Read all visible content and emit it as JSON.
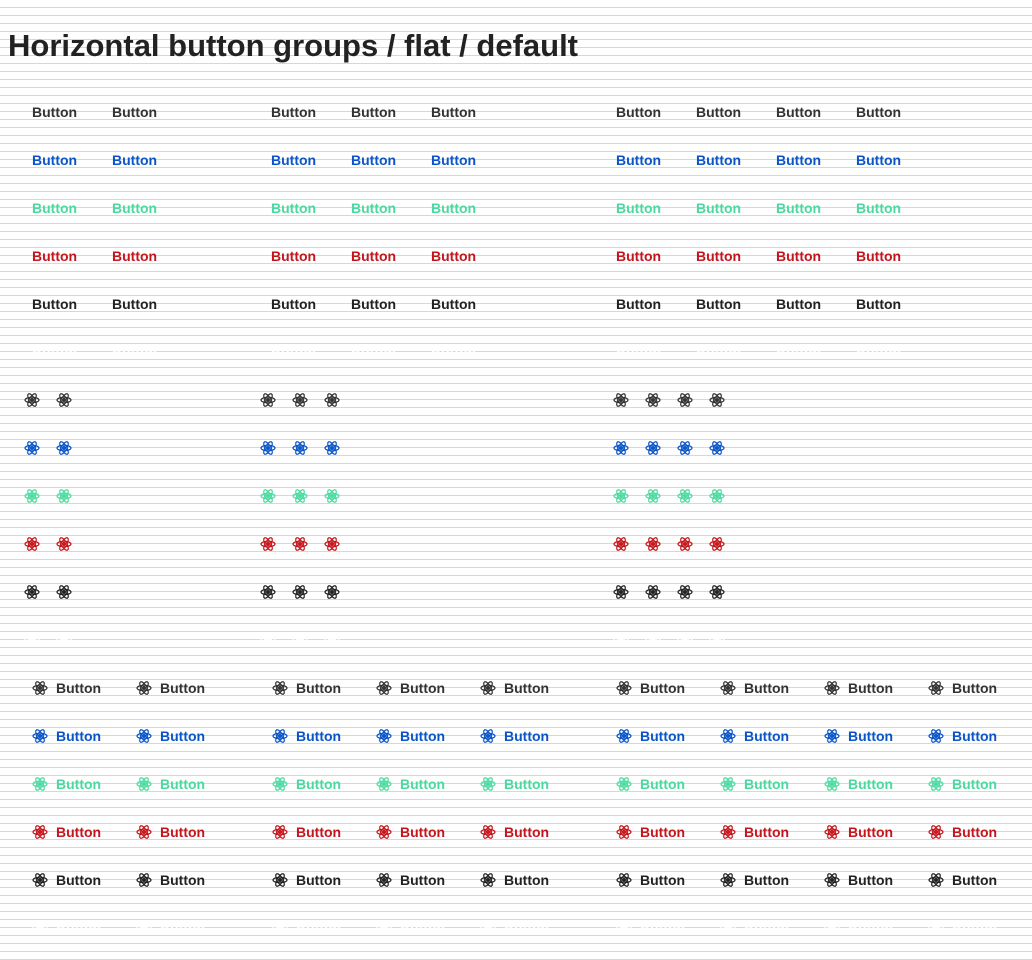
{
  "title": "Horizontal button groups / flat / default",
  "button_label": "Button",
  "icon": "atom-icon",
  "group_sizes": [
    2,
    3,
    4
  ],
  "button_types": [
    "text",
    "icon",
    "icon-text"
  ],
  "variants": [
    {
      "name": "default",
      "color": "#333333"
    },
    {
      "name": "primary",
      "color": "#0b55c8"
    },
    {
      "name": "success",
      "color": "#4cd9a0"
    },
    {
      "name": "danger",
      "color": "#c4161c"
    },
    {
      "name": "dark",
      "color": "#222222"
    },
    {
      "name": "light",
      "color": "#ffffff"
    }
  ]
}
